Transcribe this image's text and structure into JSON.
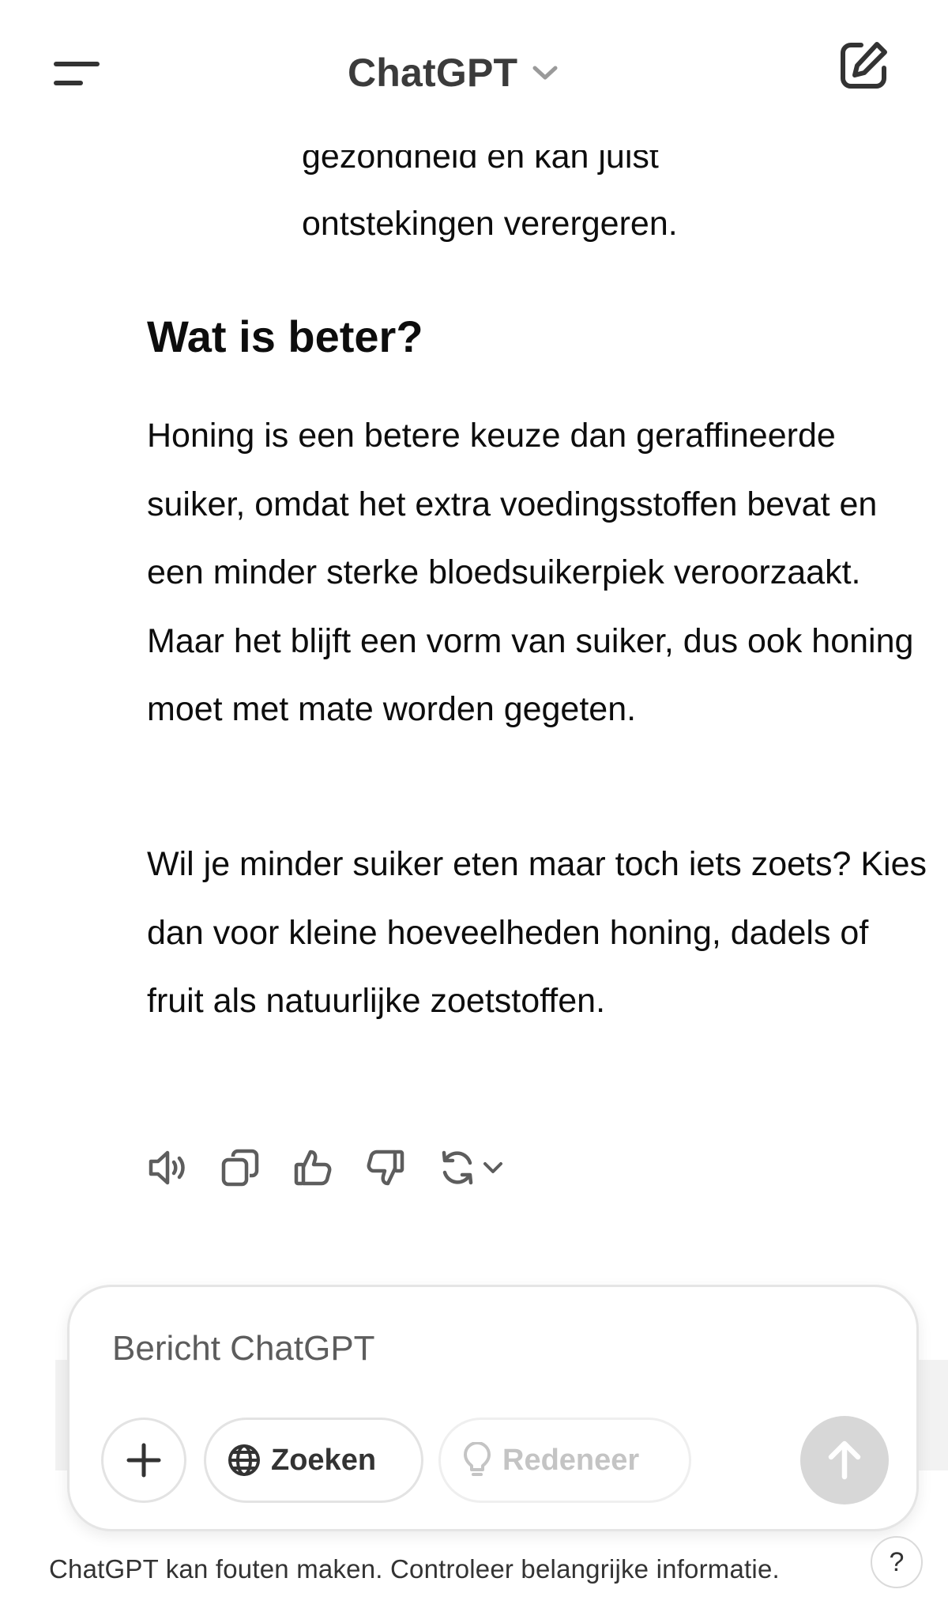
{
  "header": {
    "model_name": "ChatGPT",
    "menu_icon": "hamburger-menu-icon",
    "model_dropdown_icon": "chevron-down-icon",
    "new_chat_icon": "compose-icon"
  },
  "message": {
    "partial_lines": [
      "gezondheid en kan juist",
      "ontstekingen verergeren."
    ],
    "heading": "Wat is beter?",
    "paragraphs": [
      "Honing is een betere keuze dan geraffineerde suiker, omdat het extra voedingsstoffen bevat en een minder sterke bloedsuikerpiek veroorzaakt. Maar het blijft een vorm van suiker, dus ook honing moet met mate worden gegeten.",
      "Wil je minder suiker eten maar toch iets zoets? Kies dan voor kleine hoeveelheden honing, dadels of fruit als natuurlijke zoetstoffen."
    ],
    "actions": [
      "read-aloud-icon",
      "copy-icon",
      "thumbs-up-icon",
      "thumbs-down-icon",
      "regenerate-icon"
    ]
  },
  "composer": {
    "placeholder": "Bericht ChatGPT",
    "search_label": "Zoeken",
    "reason_label": "Redeneer",
    "attach_icon": "plus-icon",
    "send_icon": "arrow-up-icon"
  },
  "footer": {
    "disclaimer": "ChatGPT kan fouten maken. Controleer belangrijke informatie.",
    "help_label": "?"
  },
  "colors": {
    "text": "#0d0d0d",
    "muted": "#5d5d5d",
    "send_disabled": "#d7d7d7",
    "border": "#e3e3e3"
  }
}
